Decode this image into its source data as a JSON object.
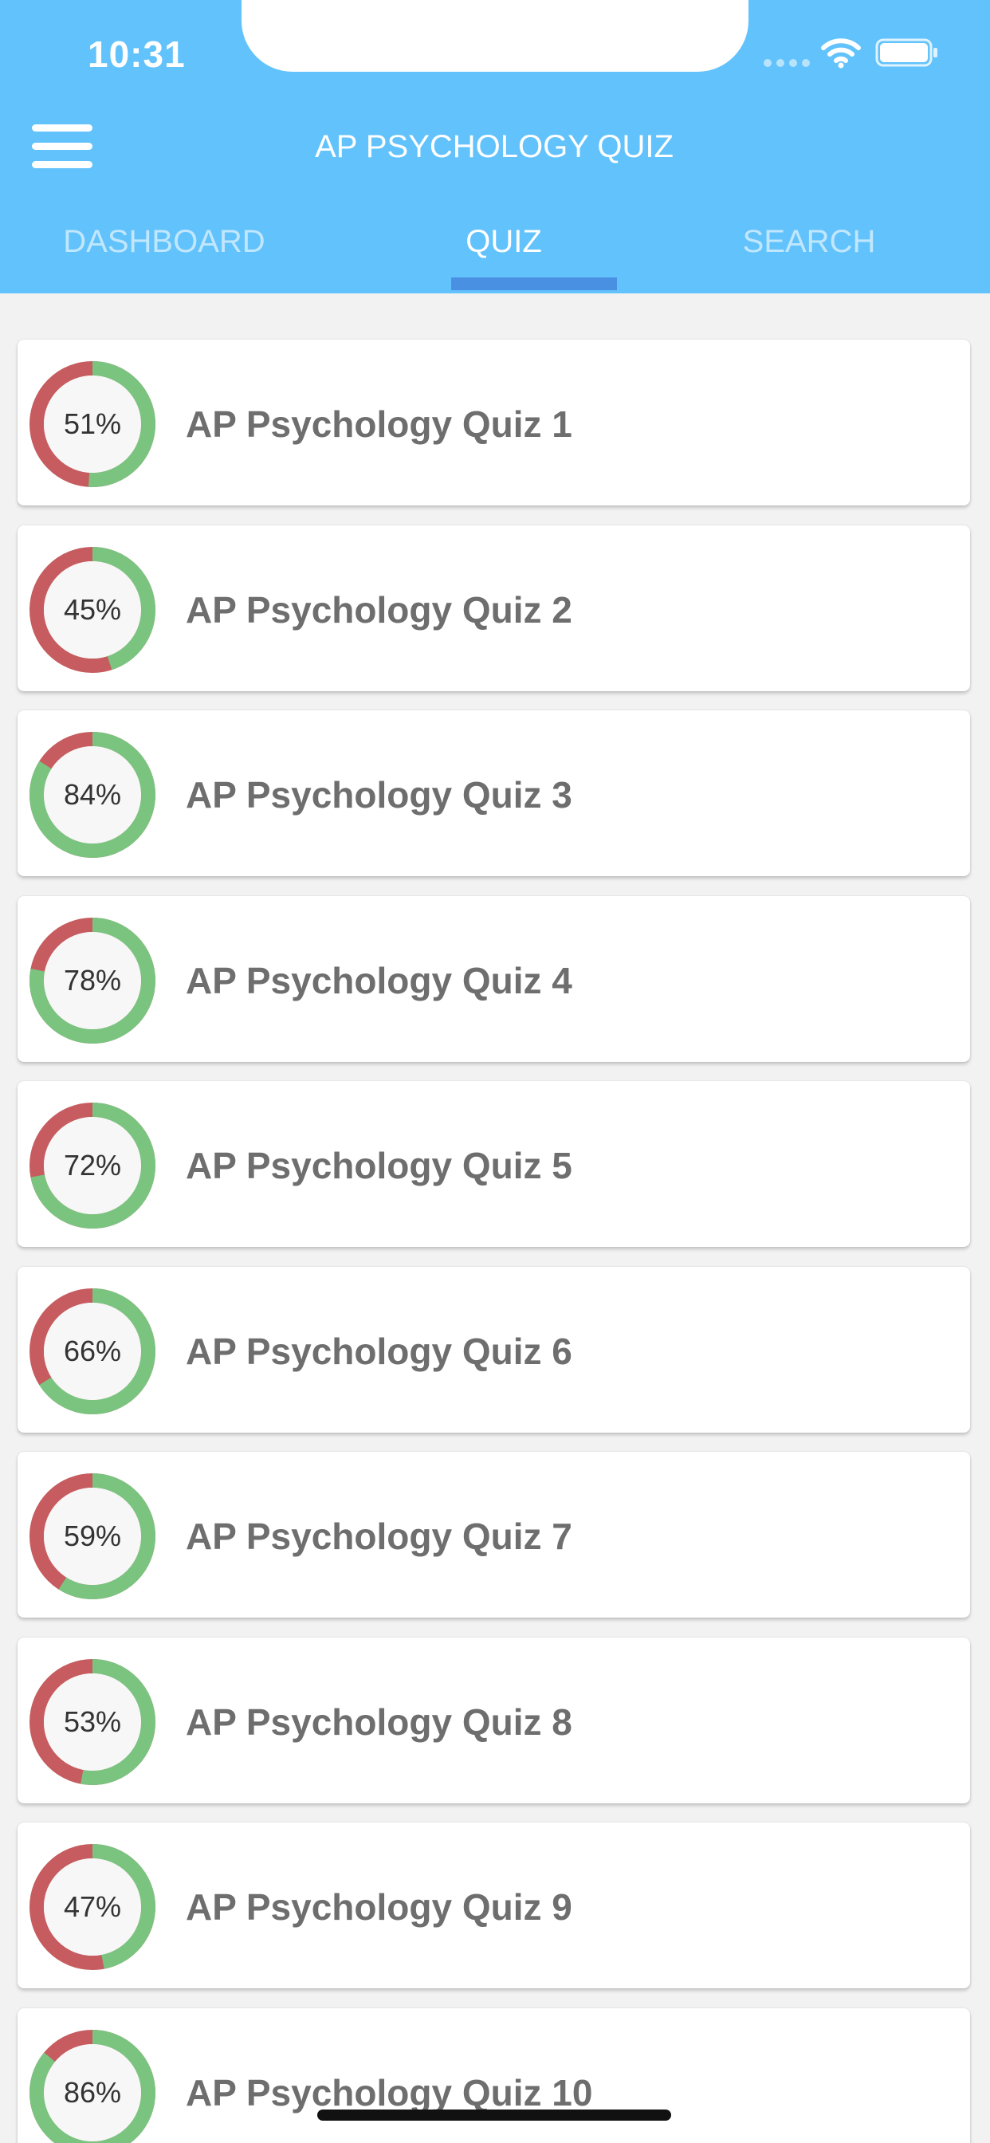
{
  "status_bar": {
    "time": "10:31"
  },
  "header": {
    "title": "AP PSYCHOLOGY QUIZ",
    "menu_icon": "hamburger-menu-icon",
    "background": "#62c2fb"
  },
  "tabs": [
    {
      "label": "DASHBOARD",
      "active": false
    },
    {
      "label": "QUIZ",
      "active": true
    },
    {
      "label": "SEARCH",
      "active": false
    }
  ],
  "colors": {
    "correct": "#7ac480",
    "incorrect": "#c65c5f",
    "indicator": "#4a90e2"
  },
  "quizzes": [
    {
      "title": "AP Psychology Quiz 1",
      "percent_label": "51%",
      "percent": 51
    },
    {
      "title": "AP Psychology Quiz 2",
      "percent_label": "45%",
      "percent": 45
    },
    {
      "title": "AP Psychology Quiz 3",
      "percent_label": "84%",
      "percent": 84
    },
    {
      "title": "AP Psychology Quiz 4",
      "percent_label": "78%",
      "percent": 78
    },
    {
      "title": "AP Psychology Quiz 5",
      "percent_label": "72%",
      "percent": 72
    },
    {
      "title": "AP Psychology Quiz 6",
      "percent_label": "66%",
      "percent": 66
    },
    {
      "title": "AP Psychology Quiz 7",
      "percent_label": "59%",
      "percent": 59
    },
    {
      "title": "AP Psychology Quiz 8",
      "percent_label": "53%",
      "percent": 53
    },
    {
      "title": "AP Psychology Quiz 9",
      "percent_label": "47%",
      "percent": 47
    },
    {
      "title": "AP Psychology Quiz 10",
      "percent_label": "86%",
      "percent": 86
    }
  ]
}
